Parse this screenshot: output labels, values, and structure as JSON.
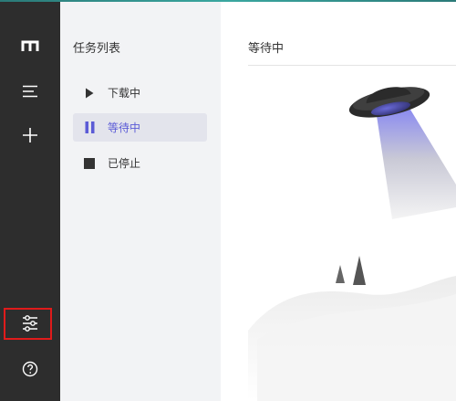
{
  "sidebar": {
    "icons": [
      "logo-icon",
      "menu-icon",
      "plus-icon",
      "settings-icon",
      "help-icon"
    ]
  },
  "task_list": {
    "title": "任务列表",
    "items": [
      {
        "label": "下载中",
        "icon": "play-icon"
      },
      {
        "label": "等待中",
        "icon": "pause-icon",
        "active": true
      },
      {
        "label": "已停止",
        "icon": "stop-icon"
      }
    ]
  },
  "main": {
    "title": "等待中",
    "illustration": "ufo-empty-state"
  },
  "colors": {
    "rail": "#2d2d2d",
    "panel": "#f2f3f5",
    "accent": "#5b5bd6",
    "highlight": "#e01b1b"
  }
}
